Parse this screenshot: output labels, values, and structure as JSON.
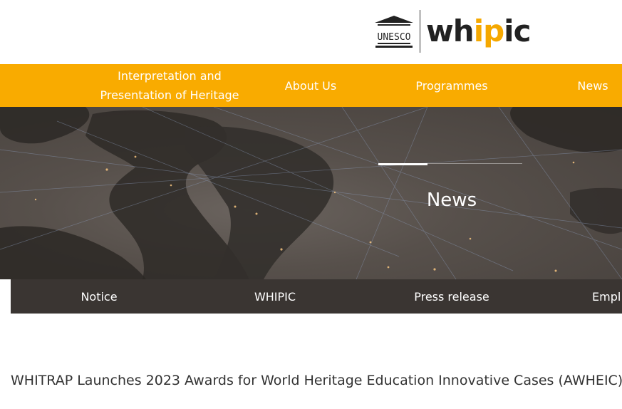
{
  "header": {
    "unesco_text": "UNESCO",
    "logo": {
      "part1": "wh",
      "part2": "ip",
      "part3": "ic"
    }
  },
  "nav": {
    "items": [
      {
        "label_line1": "Interpretation and",
        "label_line2": "Presentation of Heritage"
      },
      {
        "label": "About Us"
      },
      {
        "label": "Programmes"
      },
      {
        "label": "News"
      }
    ]
  },
  "hero": {
    "title": "News"
  },
  "subnav": {
    "items": [
      "Notice",
      "WHIPIC",
      "Press release",
      "Empl"
    ]
  },
  "article": {
    "title": "WHITRAP Launches 2023 Awards for World Heritage Education Innovative Cases (AWHEIC)"
  },
  "colors": {
    "nav_bg": "#f9ab00",
    "accent": "#f5a800",
    "subnav_bg": "#3a3532"
  }
}
